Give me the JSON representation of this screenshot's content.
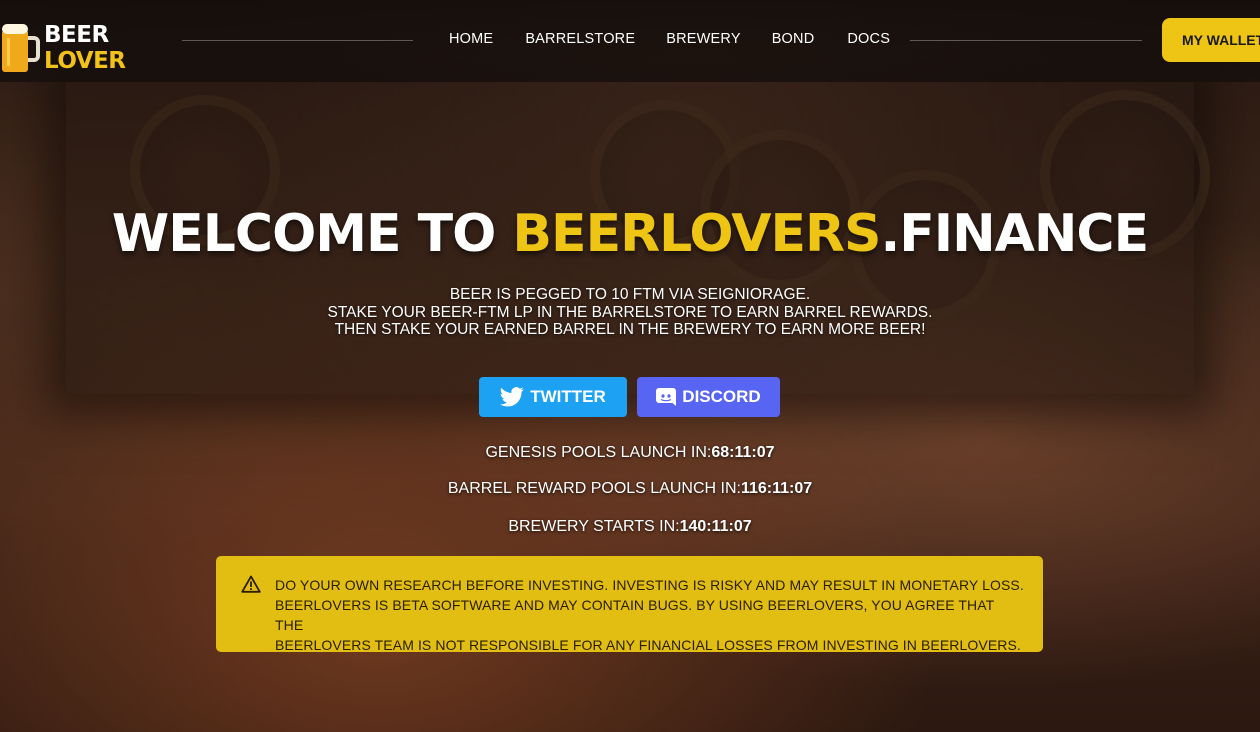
{
  "logo": {
    "line1": "BEER",
    "line2": "LOVER",
    "icon": "beer-mug-icon",
    "accent_color": "#f2c21a"
  },
  "nav": {
    "items": [
      "HOME",
      "BARRELSTORE",
      "BREWERY",
      "BOND",
      "DOCS"
    ]
  },
  "wallet_button": {
    "label": "MY WALLET"
  },
  "hero": {
    "title_prefix": "WELCOME TO ",
    "title_accent": "BEERLOVERS",
    "title_suffix": ".FINANCE",
    "subtitle_lines": [
      "BEER IS PEGGED TO 10 FTM VIA SEIGNIORAGE.",
      "STAKE YOUR BEER-FTM LP IN THE BARRELSTORE TO EARN BARREL REWARDS.",
      "THEN STAKE YOUR EARNED BARREL IN THE BREWERY TO EARN MORE BEER!"
    ]
  },
  "social": {
    "twitter": {
      "label": "TWITTER",
      "icon": "twitter-bird-icon",
      "color": "#1da1f2"
    },
    "discord": {
      "label": "DISCORD",
      "icon": "discord-icon",
      "color": "#5865f2"
    }
  },
  "countdowns": [
    {
      "label": "GENESIS POOLS LAUNCH IN:",
      "time": "68:11:07"
    },
    {
      "label": "BARREL REWARD POOLS LAUNCH IN:",
      "time": "116:11:07"
    },
    {
      "label": "BREWERY STARTS IN:",
      "time": "140:11:07"
    }
  ],
  "warning": {
    "icon": "warning-triangle-icon",
    "color": "#e3be12",
    "lines": [
      "DO YOUR OWN RESEARCH BEFORE INVESTING. INVESTING IS RISKY AND MAY RESULT IN MONETARY LOSS.",
      "BEERLOVERS IS BETA SOFTWARE AND MAY CONTAIN BUGS. BY USING BEERLOVERS, YOU AGREE THAT THE",
      "BEERLOVERS TEAM IS NOT RESPONSIBLE FOR ANY FINANCIAL LOSSES FROM INVESTING IN BEERLOVERS."
    ]
  }
}
